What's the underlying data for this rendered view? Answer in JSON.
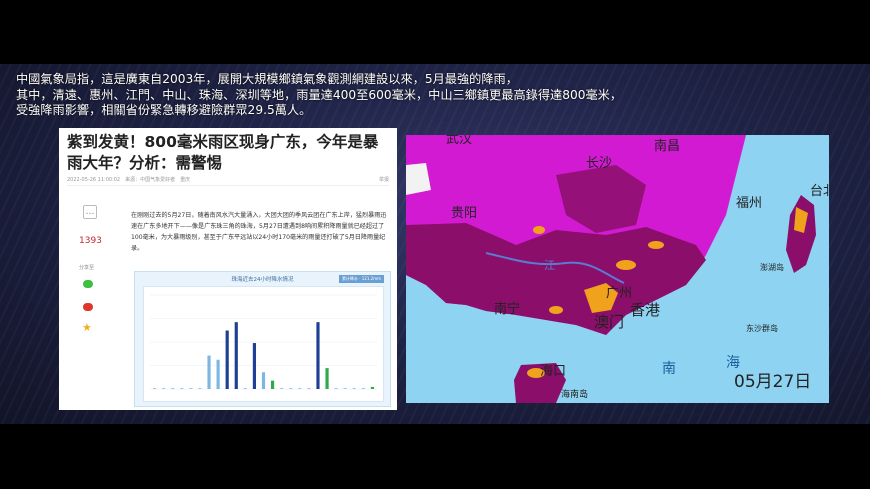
{
  "caption": {
    "line1": "中國氣象局指，這是廣東自2003年，展開大規模鄉鎮氣象觀測網建設以來，5月最強的降雨，",
    "line2": "其中，清遠、惠州、江門、中山、珠海、深圳等地，雨量達400至600毫米，中山三鄉鎮更最高錄得達800毫米，",
    "line3": "受強降雨影響，相關省份緊急轉移避險群眾29.5萬人。"
  },
  "article": {
    "title": "紫到发黄！800毫米雨区现身广东，今年是暴雨大年？分析：需警惕",
    "meta": "2022-05-26 11:00:02　来源：中国气象爱好者　重庆",
    "meta_right": "举报",
    "like_count": "1393",
    "share_label": "分享至",
    "body": "在刚刚过去的5月27日，随着南风水汽大量涌入，大团大团的季风云团在广东上岸，猛烈暴雨迅速在广东多地开下——像是广东珠三角的珠海，5月27日遭遇到8响间累积降雨量就已经超过了100毫米，为大暴雨级别，甚至于广东平远站以24小时170毫米的雨量还打破了5月日降雨量纪录。",
    "chart_title": "珠海近去24小时降水情况",
    "chart_badge": "累计降水 · 121.2mm"
  },
  "chart_data": {
    "type": "bar",
    "title": "珠海近去24小时降水情况",
    "xlabel": "",
    "ylabel": "",
    "ylim": [
      0,
      45
    ],
    "values": [
      0.5,
      0.5,
      0.5,
      0.5,
      0.5,
      0.5,
      16,
      14,
      28,
      32,
      0.5,
      22,
      8,
      4,
      0.5,
      0.5,
      0.5,
      0.5,
      32,
      10,
      0.5,
      0.5,
      0.5,
      0.5,
      1
    ],
    "colors": [
      "#9ec9ec",
      "#9ec9ec",
      "#9ec9ec",
      "#9ec9ec",
      "#9ec9ec",
      "#9ec9ec",
      "#7cb7e4",
      "#7cb7e4",
      "#1f3f96",
      "#1f3f96",
      "#9ec9ec",
      "#1f3f96",
      "#7cb7e4",
      "#2fa84f",
      "#9ec9ec",
      "#9ec9ec",
      "#9ec9ec",
      "#9ec9ec",
      "#1f3f96",
      "#2fa84f",
      "#9ec9ec",
      "#9ec9ec",
      "#9ec9ec",
      "#9ec9ec",
      "#2fa84f"
    ]
  },
  "map": {
    "labels": {
      "wuhan": "武汉",
      "changsha": "长沙",
      "nanchang": "南昌",
      "guiyang": "贵阳",
      "fuzhou": "福州",
      "taibei": "台北",
      "nanning": "南宁",
      "guangzhou": "广州",
      "hongkong": "香港",
      "macau": "澳门",
      "haikou": "海口",
      "hainan": "海南岛",
      "penghu": "澎湖岛",
      "dongsha": "东沙群岛",
      "sea1": "海",
      "sea2": "南",
      "river": "江"
    },
    "date": "05月27日",
    "colors": {
      "sea": "#8ed3f2",
      "magenta": "#d21ad2",
      "purple": "#8b0f6a",
      "orange": "#f1a21d",
      "land": "#f7f7f7"
    }
  }
}
